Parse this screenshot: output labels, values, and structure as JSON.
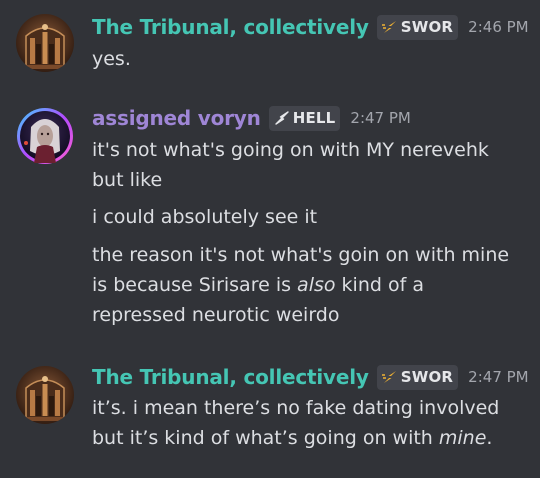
{
  "colors": {
    "background": "#313338",
    "tribunal_name": "#45c6b4",
    "voryn_name": "#9f86d6",
    "text": "#dcdee2",
    "timestamp": "#a3a6ad",
    "tag_bg": "#42444b"
  },
  "messages": [
    {
      "author": "The Tribunal, collectively",
      "tag": "SWOR",
      "tag_icon": "lightning-icon",
      "time": "2:46 PM",
      "avatar_icon": "shrine-avatar-icon",
      "lines": [
        "yes."
      ]
    },
    {
      "author": "assigned voryn",
      "tag": "HELL",
      "tag_icon": "lightning-outline-icon",
      "time": "2:47 PM",
      "avatar_icon": "character-portrait-avatar-icon",
      "lines": [
        "it's not what's going on with MY nerevehk",
        "but like",
        "i could absolutely see it",
        "the reason it's not what's goin on with mine",
        "is because Sirisare is ",
        "also",
        " kind of a",
        "repressed neurotic weirdo"
      ]
    },
    {
      "author": "The Tribunal, collectively",
      "tag": "SWOR",
      "tag_icon": "lightning-icon",
      "time": "2:47 PM",
      "avatar_icon": "shrine-avatar-icon",
      "lines": [
        "it’s. i mean there’s no fake dating involved",
        "but it’s kind of what’s going on with ",
        "mine",
        "."
      ]
    }
  ]
}
